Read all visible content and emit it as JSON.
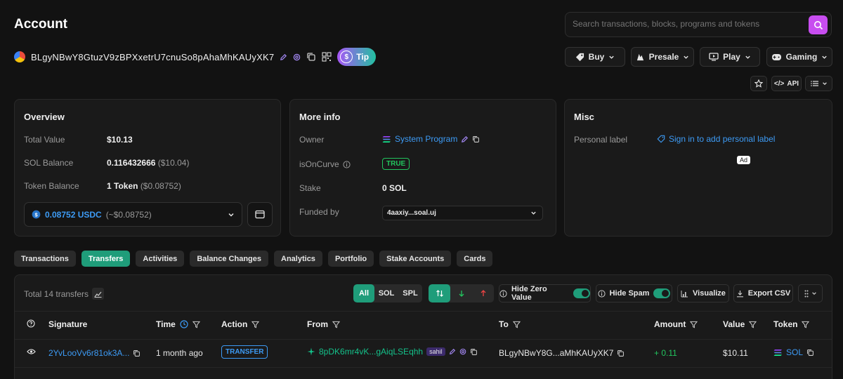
{
  "page": {
    "title": "Account"
  },
  "search": {
    "placeholder": "Search transactions, blocks, programs and tokens"
  },
  "account": {
    "address": "BLgyNBwY8GtuzV9zBPXxetrU7cnuSo8pAhaMhKAUyXK7",
    "tip_label": "Tip"
  },
  "nav": {
    "buy": "Buy",
    "presale": "Presale",
    "play": "Play",
    "gaming": "Gaming",
    "api": "API"
  },
  "overview": {
    "title": "Overview",
    "total_value_label": "Total Value",
    "total_value": "$10.13",
    "sol_balance_label": "SOL Balance",
    "sol_balance": "0.116432666",
    "sol_balance_usd": "($10.04)",
    "token_balance_label": "Token Balance",
    "token_balance": "1 Token",
    "token_balance_usd": "($0.08752)",
    "token_select_amount": "0.08752 USDC",
    "token_select_usd": "(~$0.08752)"
  },
  "more_info": {
    "title": "More info",
    "owner_label": "Owner",
    "owner_value": "System Program",
    "is_on_curve_label": "isOnCurve",
    "is_on_curve_value": "TRUE",
    "stake_label": "Stake",
    "stake_value": "0 SOL",
    "funded_by_label": "Funded by",
    "funded_by_value": "4aaxiy...soal.uj"
  },
  "misc": {
    "title": "Misc",
    "personal_label_label": "Personal label",
    "personal_label_link": "Sign in to add personal label",
    "ad_label": "Ad"
  },
  "tabs": [
    "Transactions",
    "Transfers",
    "Activities",
    "Balance Changes",
    "Analytics",
    "Portfolio",
    "Stake Accounts",
    "Cards"
  ],
  "active_tab": "Transfers",
  "transfers": {
    "total_label": "Total 14 transfers",
    "filter_all": "All",
    "filter_sol": "SOL",
    "filter_spl": "SPL",
    "hide_zero_label": "Hide Zero Value",
    "hide_spam_label": "Hide Spam",
    "visualize_label": "Visualize",
    "export_label": "Export CSV",
    "columns": [
      "Signature",
      "Time",
      "Action",
      "From",
      "To",
      "Amount",
      "Value",
      "Token"
    ],
    "rows": [
      {
        "signature": "2YvLooVv6r81ok3A...",
        "time": "1 month ago",
        "action": "TRANSFER",
        "from": "8pDK6mr4vK...gAiqLSEqhh",
        "from_tag": "sahil",
        "to": "BLgyNBwY8G...aMhKAUyXK7",
        "amount": "+ 0.11",
        "value": "$10.11",
        "token": "SOL"
      }
    ]
  },
  "colors": {
    "accent": "#1f9d7a",
    "link": "#3d9bf5",
    "search_button": "#c84df0",
    "positive": "#22c55e"
  }
}
